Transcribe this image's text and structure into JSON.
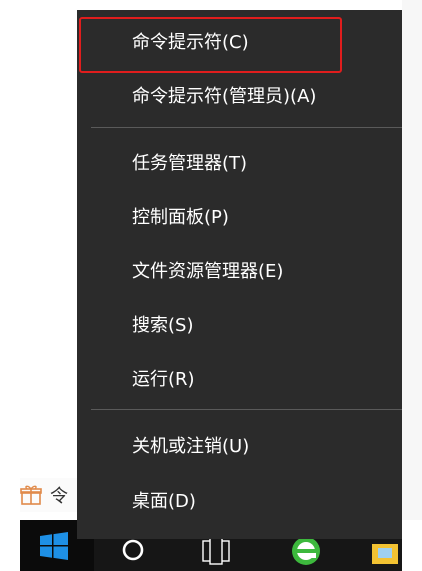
{
  "menu": {
    "items": [
      {
        "label": "命令提示符(C)"
      },
      {
        "label": "命令提示符(管理员)(A)"
      },
      {
        "label": "任务管理器(T)"
      },
      {
        "label": "控制面板(P)"
      },
      {
        "label": "文件资源管理器(E)"
      },
      {
        "label": "搜索(S)"
      },
      {
        "label": "运行(R)"
      },
      {
        "label": "关机或注销(U)"
      },
      {
        "label": "桌面(D)"
      }
    ]
  },
  "background_list": {
    "partial_text": "令"
  },
  "colors": {
    "menu_background": "#2b2b2b",
    "menu_text": "#ffffff",
    "separator": "#5a5a5a",
    "highlight_border": "#e01d1d",
    "taskbar": "#161616",
    "start_icon": "#1e90e6"
  },
  "icons": {
    "behind_item": "gift-icon",
    "taskbar": [
      "windows-start-icon",
      "search-circle-icon",
      "task-view-icon",
      "browser-e-icon",
      "file-explorer-icon"
    ]
  }
}
